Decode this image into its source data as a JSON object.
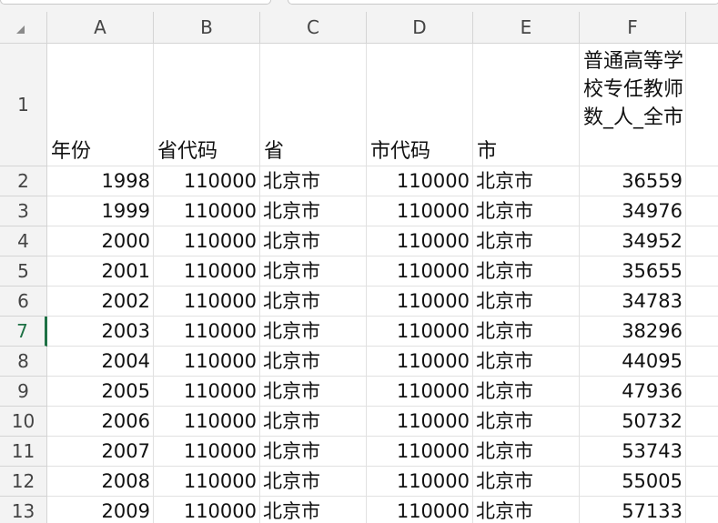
{
  "columns": [
    {
      "letter": "A"
    },
    {
      "letter": "B"
    },
    {
      "letter": "C"
    },
    {
      "letter": "D"
    },
    {
      "letter": "E"
    },
    {
      "letter": "F"
    }
  ],
  "header_row": {
    "row_number": "1",
    "cells": [
      "年份",
      "省代码",
      "省",
      "市代码",
      "市",
      "普通高等学校专任教师数_人_全市"
    ]
  },
  "active_row": "7",
  "rows": [
    {
      "num": "2",
      "cells": [
        "1998",
        "110000",
        "北京市",
        "110000",
        "北京市",
        "36559"
      ]
    },
    {
      "num": "3",
      "cells": [
        "1999",
        "110000",
        "北京市",
        "110000",
        "北京市",
        "34976"
      ]
    },
    {
      "num": "4",
      "cells": [
        "2000",
        "110000",
        "北京市",
        "110000",
        "北京市",
        "34952"
      ]
    },
    {
      "num": "5",
      "cells": [
        "2001",
        "110000",
        "北京市",
        "110000",
        "北京市",
        "35655"
      ]
    },
    {
      "num": "6",
      "cells": [
        "2002",
        "110000",
        "北京市",
        "110000",
        "北京市",
        "34783"
      ]
    },
    {
      "num": "7",
      "cells": [
        "2003",
        "110000",
        "北京市",
        "110000",
        "北京市",
        "38296"
      ]
    },
    {
      "num": "8",
      "cells": [
        "2004",
        "110000",
        "北京市",
        "110000",
        "北京市",
        "44095"
      ]
    },
    {
      "num": "9",
      "cells": [
        "2005",
        "110000",
        "北京市",
        "110000",
        "北京市",
        "47936"
      ]
    },
    {
      "num": "10",
      "cells": [
        "2006",
        "110000",
        "北京市",
        "110000",
        "北京市",
        "50732"
      ]
    },
    {
      "num": "11",
      "cells": [
        "2007",
        "110000",
        "北京市",
        "110000",
        "北京市",
        "53743"
      ]
    },
    {
      "num": "12",
      "cells": [
        "2008",
        "110000",
        "北京市",
        "110000",
        "北京市",
        "55005"
      ]
    },
    {
      "num": "13",
      "cells": [
        "2009",
        "110000",
        "北京市",
        "110000",
        "北京市",
        "57133"
      ]
    }
  ]
}
